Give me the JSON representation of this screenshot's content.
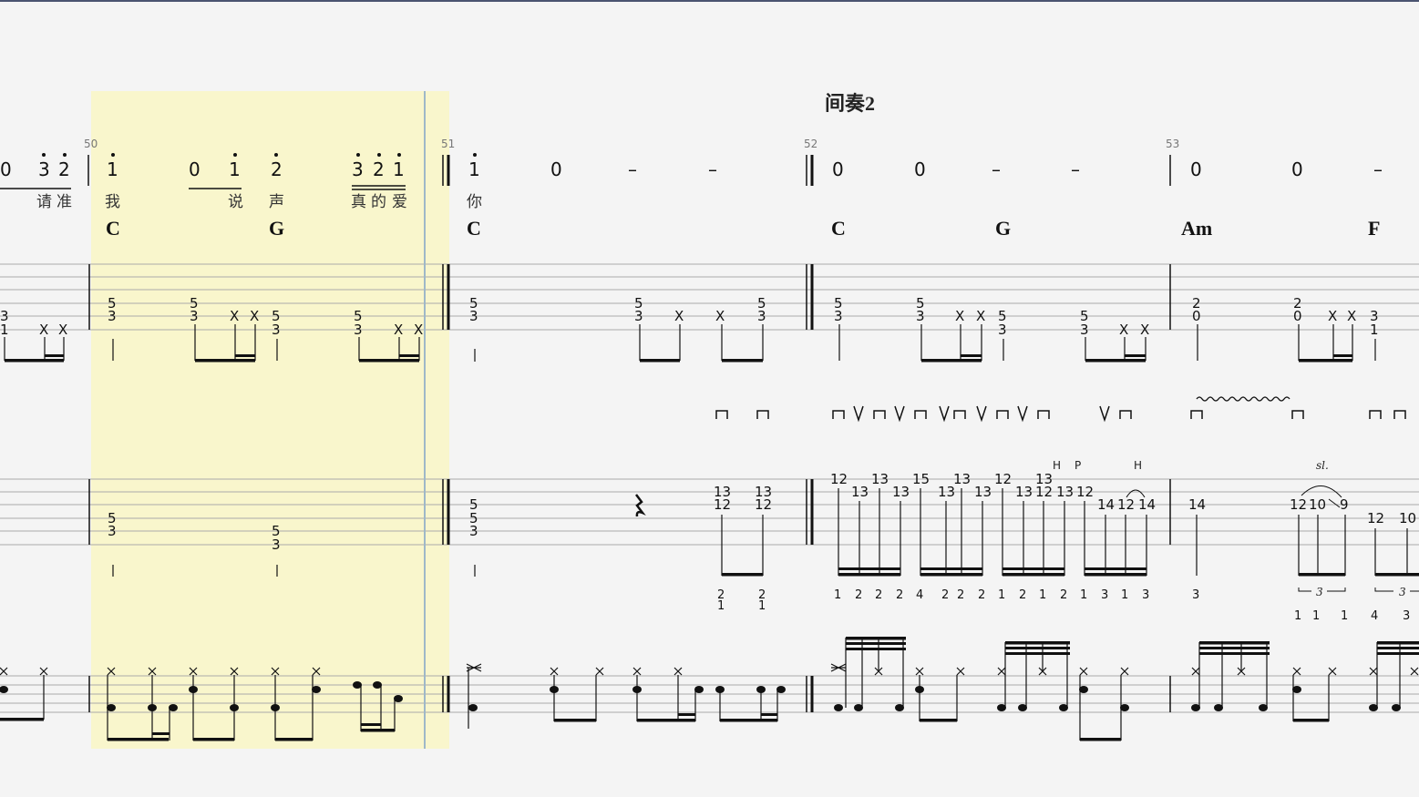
{
  "section_title": "间奏2",
  "measure_numbers": [
    "50",
    "51",
    "52",
    "53"
  ],
  "lyrics": [
    "请",
    "准",
    "我",
    "说",
    "声",
    "真",
    "的",
    "爱",
    "你"
  ],
  "chords": [
    "C",
    "G",
    "C",
    "C",
    "G",
    "Am",
    "F"
  ],
  "jianpu": [
    "0",
    "3",
    "2",
    "1",
    "0",
    "1",
    "2",
    "3",
    "2",
    "1",
    "1",
    "0",
    "–",
    "–",
    "0",
    "0",
    "–",
    "–",
    "0",
    "0",
    "–"
  ],
  "techniques": {
    "hammer": "H",
    "pull": "P",
    "slide": "sl.",
    "triplet": "3"
  },
  "rhythm_tab": {
    "m49": [
      "3",
      "1",
      "X",
      "X"
    ],
    "m50": [
      "5",
      "3",
      "5",
      "3",
      "X",
      "X",
      "5",
      "3",
      "5",
      "3",
      "X",
      "X"
    ],
    "m51": [
      "5",
      "3",
      "5",
      "3",
      "X",
      "X",
      "5",
      "3"
    ],
    "m52": [
      "5",
      "3",
      "5",
      "3",
      "X",
      "X",
      "5",
      "3",
      "5",
      "3",
      "X",
      "X"
    ],
    "m53": [
      "2",
      "0",
      "2",
      "0",
      "X",
      "X",
      "3",
      "1"
    ]
  },
  "lead_tab": {
    "m50": [
      "5",
      "3",
      "5",
      "3"
    ],
    "m51": [
      "5",
      "5",
      "3",
      "13",
      "12",
      "13",
      "12"
    ],
    "m52_top": [
      "12",
      "13",
      "15",
      "13",
      "12",
      "13"
    ],
    "m52_bottom": [
      "13",
      "13",
      "13",
      "13",
      "13",
      "12",
      "13",
      "12",
      "14",
      "12",
      "14"
    ],
    "m53": [
      "14",
      "12",
      "10",
      "9",
      "12",
      "10"
    ]
  },
  "fingering": [
    "2",
    "1",
    "2",
    "1",
    "1",
    "2",
    "2",
    "2",
    "4",
    "2",
    "2",
    "2",
    "1",
    "2",
    "1",
    "2",
    "1",
    "3",
    "1",
    "3",
    "3",
    "1",
    "1",
    "1",
    "4",
    "3"
  ]
}
